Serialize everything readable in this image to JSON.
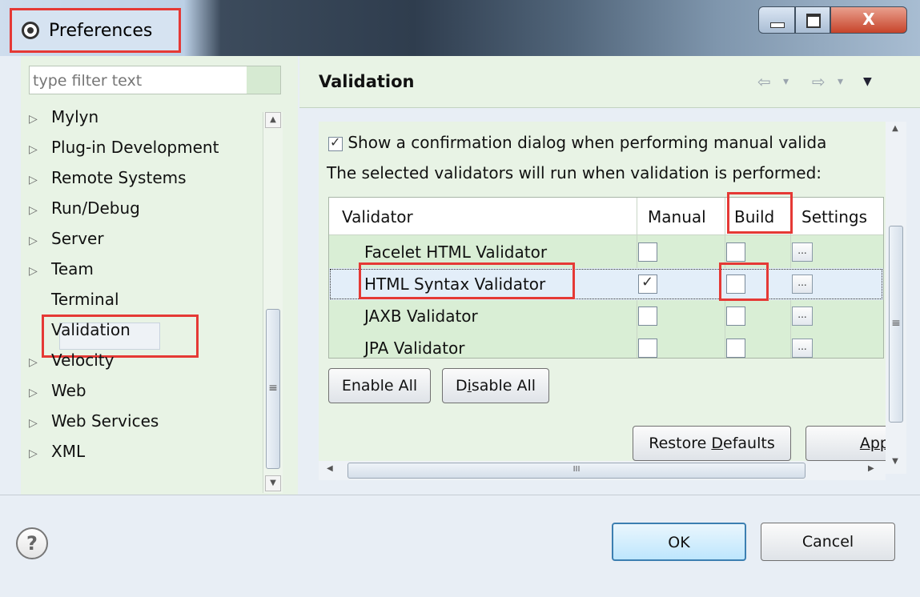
{
  "window": {
    "title": "Preferences",
    "controls": {
      "minimize_icon": "minimize-icon",
      "maximize_icon": "maximize-icon",
      "close_label": "X"
    }
  },
  "sidebar": {
    "filter_placeholder": "type filter text",
    "items": [
      {
        "label": "Mylyn",
        "expandable": true
      },
      {
        "label": "Plug-in Development",
        "expandable": true
      },
      {
        "label": "Remote Systems",
        "expandable": true
      },
      {
        "label": "Run/Debug",
        "expandable": true
      },
      {
        "label": "Server",
        "expandable": true
      },
      {
        "label": "Team",
        "expandable": true
      },
      {
        "label": "Terminal",
        "expandable": false
      },
      {
        "label": "Validation",
        "expandable": false,
        "selected": true
      },
      {
        "label": "Velocity",
        "expandable": true
      },
      {
        "label": "Web",
        "expandable": true
      },
      {
        "label": "Web Services",
        "expandable": true
      },
      {
        "label": "XML",
        "expandable": true
      }
    ]
  },
  "page": {
    "title": "Validation",
    "nav": {
      "back": "⇦",
      "forward": "⇨",
      "dropdown": "▾",
      "menu": "▼"
    },
    "confirm_label": "Show a confirmation dialog when performing manual valida",
    "confirm_checked": true,
    "description": "The selected validators will run when validation is performed:",
    "table": {
      "columns": [
        "Validator",
        "Manual",
        "Build",
        "Settings"
      ],
      "rows": [
        {
          "name": "Facelet HTML Validator",
          "manual": false,
          "build": false,
          "settings": "..."
        },
        {
          "name": "HTML Syntax Validator",
          "manual": true,
          "build": false,
          "settings": "...",
          "selected": true
        },
        {
          "name": "JAXB Validator",
          "manual": false,
          "build": false,
          "settings": "..."
        },
        {
          "name": "JPA Validator",
          "manual": false,
          "build": false,
          "settings": "..."
        }
      ]
    },
    "buttons": {
      "enable_all": "Enable All",
      "disable_all_pre": "D",
      "disable_all_u": "i",
      "disable_all_post": "sable All",
      "restore_pre": "Restore ",
      "restore_u": "D",
      "restore_post": "efaults",
      "apply": "App"
    },
    "hscroll_grip": "III",
    "vscroll_grip": "≡"
  },
  "footer": {
    "help_label": "?",
    "ok_label": "OK",
    "cancel_label": "Cancel"
  },
  "colors": {
    "highlight": "#e53935",
    "panel_bg": "#e8f3e5",
    "ok_border": "#3c7fb1"
  }
}
